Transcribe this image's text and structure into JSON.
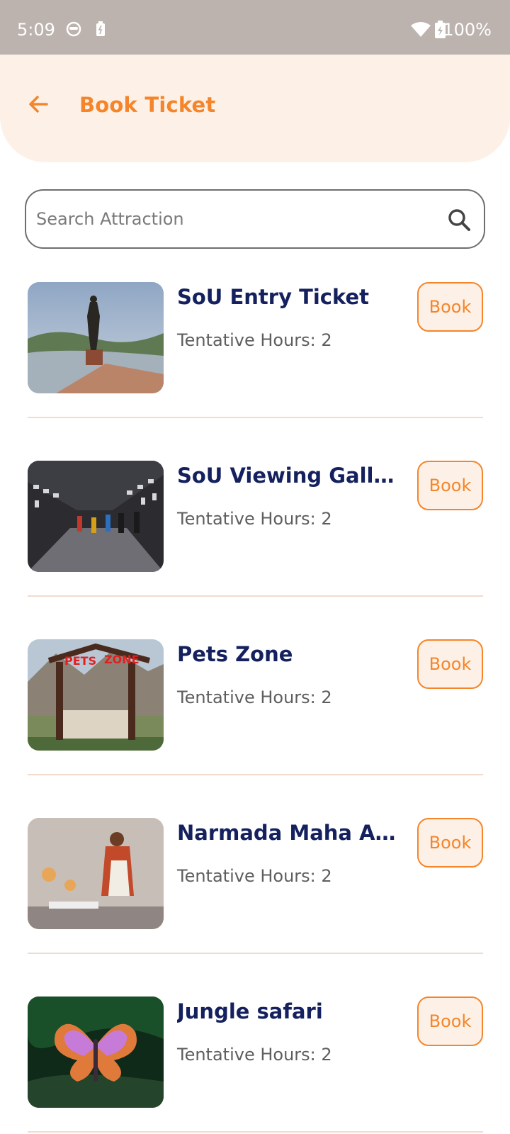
{
  "status_bar": {
    "time": "5:09",
    "battery_percent": "100%",
    "icons": [
      "face-icon",
      "battery-saver-icon",
      "wifi-icon",
      "battery-charging-icon"
    ]
  },
  "header": {
    "back_icon": "arrow-left-icon",
    "title": "Book Ticket"
  },
  "search": {
    "placeholder": "Search Attraction",
    "value": "",
    "icon": "search-icon"
  },
  "colors": {
    "accent": "#f5852a",
    "accent_bg": "#fdf1e7",
    "title_navy": "#14215e",
    "status_bar": "#bcb3ae"
  },
  "attractions": [
    {
      "title": " SoU Entry Ticket",
      "hours": "Tentative Hours: 2",
      "book_label": "Book"
    },
    {
      "title": "SoU Viewing Gallery",
      "hours": "Tentative Hours: 2",
      "book_label": "Book"
    },
    {
      "title": " Pets Zone",
      "hours": "Tentative Hours: 2",
      "book_label": "Book"
    },
    {
      "title": "Narmada Maha Aarti",
      "hours": "Tentative Hours: 2",
      "book_label": "Book"
    },
    {
      "title": "Jungle safari",
      "hours": "Tentative Hours: 2",
      "book_label": "Book"
    }
  ]
}
